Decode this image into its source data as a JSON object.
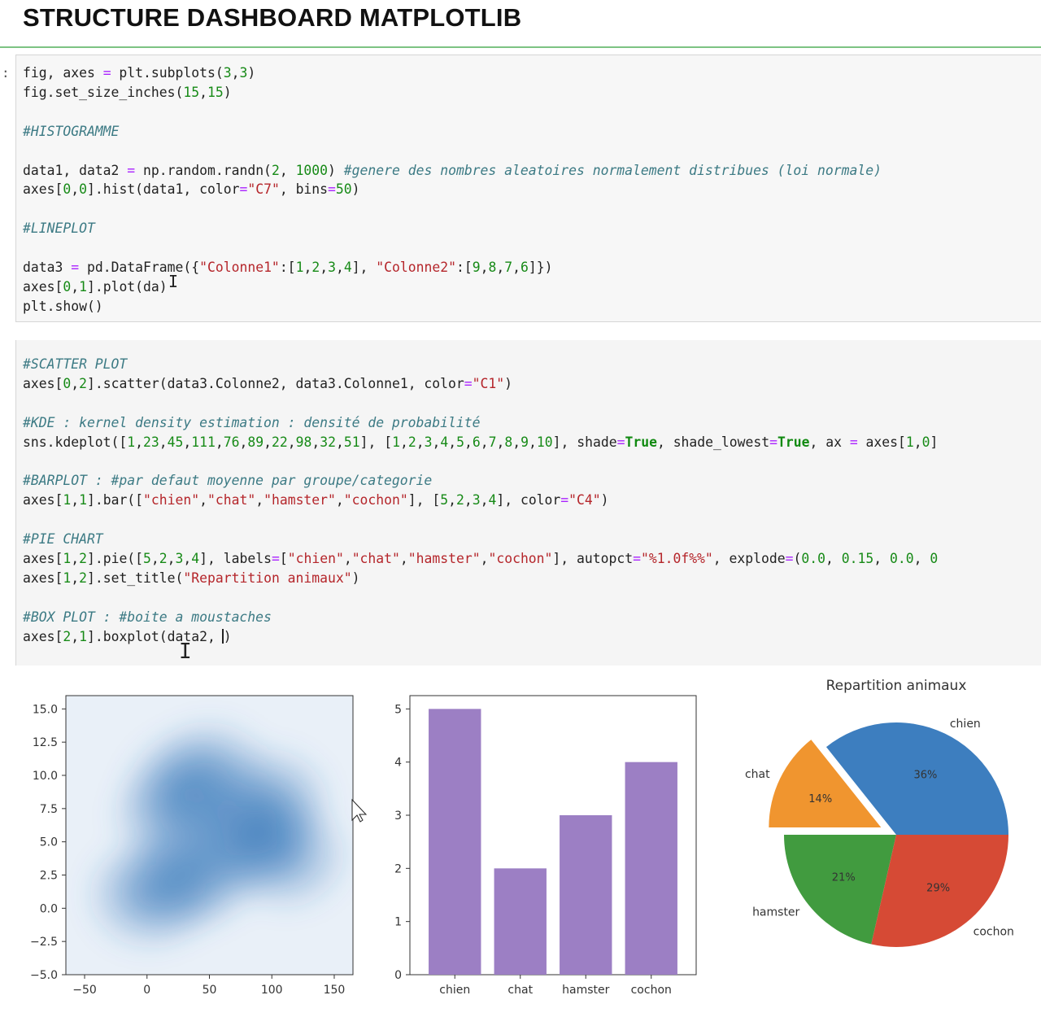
{
  "page_title": "STRUCTURE DASHBOARD MATPLOTLIB",
  "prompt": ":",
  "cell1_lines": [
    "fig, axes = plt.subplots(3,3)",
    "fig.set_size_inches(15,15)",
    "",
    "#HISTOGRAMME",
    "",
    "data1, data2 = np.random.randn(2, 1000) #genere des nombres aleatoires normalement distribues (loi normale)",
    "axes[0,0].hist(data1, color=\"C7\", bins=50)",
    "",
    "#LINEPLOT",
    "",
    "data3 = pd.DataFrame({\"Colonne1\":[1,2,3,4], \"Colonne2\":[9,8,7,6]})",
    "axes[0,1].plot(da)",
    "plt.show()"
  ],
  "cell2_lines": [
    "#SCATTER PLOT",
    "axes[0,2].scatter(data3.Colonne2, data3.Colonne1, color=\"C1\")",
    "",
    "#KDE : kernel density estimation : densité de probabilité",
    "sns.kdeplot([1,23,45,111,76,89,22,98,32,51], [1,2,3,4,5,6,7,8,9,10], shade=True, shade_lowest=True, ax = axes[1,0]",
    "",
    "#BARPLOT : #par defaut moyenne par groupe/categorie",
    "axes[1,1].bar([\"chien\",\"chat\",\"hamster\",\"cochon\"], [5,2,3,4], color=\"C4\")",
    "",
    "#PIE CHART",
    "axes[1,2].pie([5,2,3,4], labels=[\"chien\",\"chat\",\"hamster\",\"cochon\"], autopct=\"%1.0f%%\", explode=(0.0, 0.15, 0.0, 0",
    "axes[1,2].set_title(\"Repartition animaux\")",
    "",
    "#BOX PLOT : #boite a moustaches",
    "axes[2,1].boxplot(data2, )"
  ],
  "chart_data": [
    {
      "type": "heatmap",
      "title": "",
      "xlabel": "",
      "ylabel": "",
      "xlim": [
        -65,
        165
      ],
      "ylim": [
        -5,
        16
      ],
      "xticks": [
        "−50",
        "0",
        "50",
        "100",
        "150"
      ],
      "yticks": [
        "−5.0",
        "−2.5",
        "0.0",
        "2.5",
        "5.0",
        "7.5",
        "10.0",
        "12.5",
        "15.0"
      ],
      "x": [
        1,
        23,
        45,
        111,
        76,
        89,
        22,
        98,
        32,
        51
      ],
      "y": [
        1,
        2,
        3,
        4,
        5,
        6,
        7,
        8,
        9,
        10
      ],
      "color": "#2f73b5"
    },
    {
      "type": "bar",
      "title": "",
      "categories": [
        "chien",
        "chat",
        "hamster",
        "cochon"
      ],
      "values": [
        5,
        2,
        3,
        4
      ],
      "ylim": [
        0,
        5.25
      ],
      "yticks": [
        "0",
        "1",
        "2",
        "3",
        "4",
        "5"
      ],
      "color": "#9c7fc4"
    },
    {
      "type": "pie",
      "title": "Repartition animaux",
      "labels": [
        "chien",
        "chat",
        "hamster",
        "cochon"
      ],
      "values": [
        5,
        2,
        3,
        4
      ],
      "percent_labels": [
        "36%",
        "14%",
        "21%",
        "29%"
      ],
      "explode": [
        0.0,
        0.15,
        0.0,
        0.0
      ],
      "colors": [
        "#3d7ebf",
        "#f0952f",
        "#419b3f",
        "#d64a35"
      ]
    }
  ]
}
